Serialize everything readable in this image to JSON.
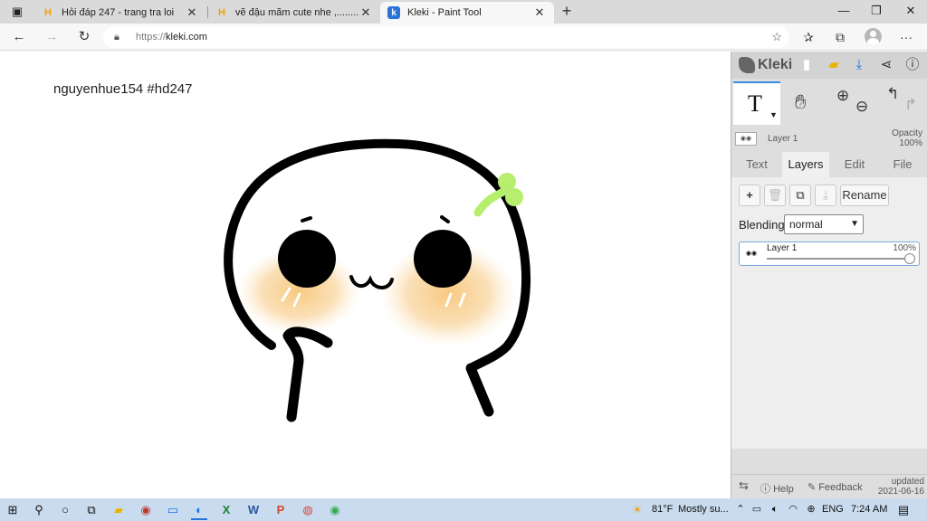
{
  "browser": {
    "tabs": [
      {
        "title": "Hỏi đáp 247 - trang tra loi",
        "favicon": "hoidap-favicon",
        "active": false
      },
      {
        "title": "vẽ đậu mãm cute nhe ,..........",
        "favicon": "hoidap-favicon",
        "active": false
      },
      {
        "title": "Kleki - Paint Tool",
        "favicon": "kleki-favicon",
        "active": true
      }
    ],
    "new_tab": "+",
    "window_controls": {
      "minimize": "—",
      "maximize": "❐",
      "close": "✕"
    },
    "address": {
      "protocol": "https://",
      "host": "kleki.com"
    }
  },
  "canvas": {
    "caption": "nguyenhue154 #hd247"
  },
  "kleki": {
    "logo": "Kleki",
    "layer_summary": {
      "name": "Layer 1",
      "opacity_label": "Opacity",
      "opacity_value": "100%"
    },
    "tabs": [
      "Text",
      "Layers",
      "Edit",
      "File"
    ],
    "active_tab": "Layers",
    "layer_buttons": {
      "add": "+",
      "rename": "Rename"
    },
    "blending_label": "Blending",
    "blending_value": "normal",
    "layers": [
      {
        "name": "Layer 1",
        "opacity": "100%"
      }
    ],
    "footer": {
      "help": "Help",
      "feedback": "Feedback",
      "updated_label": "updated",
      "updated_date": "2021-06-16"
    }
  },
  "taskbar": {
    "weather_temp": "81°F",
    "weather_desc": "Mostly su...",
    "language": "ENG",
    "time": "7:24 AM"
  },
  "colors": {
    "brand_accent": "#2a73d9",
    "blush": "#f7c77a",
    "sprout": "#b6ee6e"
  }
}
